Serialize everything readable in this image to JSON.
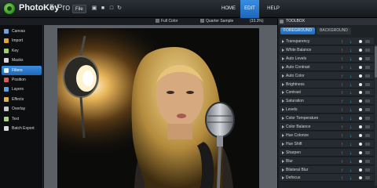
{
  "app": {
    "name": "PhotoKey",
    "version": "5 Pro",
    "file_menu": "File"
  },
  "modes": [
    {
      "label": "HOME"
    },
    {
      "label": "EDIT"
    },
    {
      "label": "HELP"
    }
  ],
  "options": {
    "fill": "Full Color",
    "sample": "Quarter Sample",
    "zoom": "(33.3%)"
  },
  "sidebar": {
    "items": [
      {
        "label": "Canvas",
        "icon": "canvas-icon",
        "color": "#6fa3d6"
      },
      {
        "label": "Import",
        "icon": "import-icon",
        "color": "#e0a340"
      },
      {
        "label": "Key",
        "icon": "key-icon",
        "color": "#9bd06a"
      },
      {
        "label": "Masks",
        "icon": "masks-icon",
        "color": "#d6d6d6"
      },
      {
        "label": "Filters",
        "icon": "filters-icon",
        "color": "#f2f2f2"
      },
      {
        "label": "Position",
        "icon": "position-icon",
        "color": "#d35b5b"
      },
      {
        "label": "Layers",
        "icon": "layers-icon",
        "color": "#5aa0e0"
      },
      {
        "label": "Effects",
        "icon": "effects-icon",
        "color": "#e3b24a"
      },
      {
        "label": "Overlay",
        "icon": "overlay-icon",
        "color": "#c9c9c9"
      },
      {
        "label": "Text",
        "icon": "text-icon",
        "color": "#a8d47a"
      },
      {
        "label": "Batch Export",
        "icon": "batch-export-icon",
        "color": "#d8d8d8"
      }
    ],
    "active_index": 4
  },
  "toolbox": {
    "title": "TOOLBOX",
    "tabs": [
      {
        "label": "FOREGROUND"
      },
      {
        "label": "BACKGROUND"
      }
    ],
    "filters": [
      {
        "label": "Transparency"
      },
      {
        "label": "White Balance"
      },
      {
        "label": "Auto Levels"
      },
      {
        "label": "Auto Contrast"
      },
      {
        "label": "Auto Color"
      },
      {
        "label": "Brightness"
      },
      {
        "label": "Contrast"
      },
      {
        "label": "Saturation"
      },
      {
        "label": "Levels"
      },
      {
        "label": "Color Temperature"
      },
      {
        "label": "Color Balance"
      },
      {
        "label": "Hue Colorize"
      },
      {
        "label": "Hue Shift"
      },
      {
        "label": "Sharpen"
      },
      {
        "label": "Blur"
      },
      {
        "label": "Bilateral Blur"
      },
      {
        "label": "Defocus"
      }
    ]
  },
  "colors": {
    "accent": "#1f67b6",
    "arrow": "#43c7e4"
  }
}
